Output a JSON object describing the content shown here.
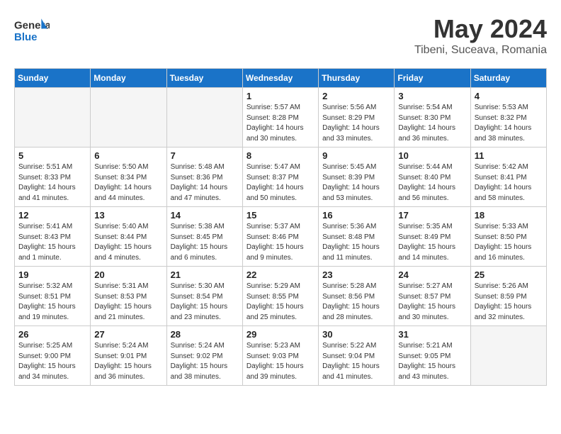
{
  "header": {
    "logo_line1": "General",
    "logo_line2": "Blue",
    "month": "May 2024",
    "location": "Tibeni, Suceava, Romania"
  },
  "days_of_week": [
    "Sunday",
    "Monday",
    "Tuesday",
    "Wednesday",
    "Thursday",
    "Friday",
    "Saturday"
  ],
  "weeks": [
    [
      {
        "day": "",
        "info": ""
      },
      {
        "day": "",
        "info": ""
      },
      {
        "day": "",
        "info": ""
      },
      {
        "day": "1",
        "info": "Sunrise: 5:57 AM\nSunset: 8:28 PM\nDaylight: 14 hours\nand 30 minutes."
      },
      {
        "day": "2",
        "info": "Sunrise: 5:56 AM\nSunset: 8:29 PM\nDaylight: 14 hours\nand 33 minutes."
      },
      {
        "day": "3",
        "info": "Sunrise: 5:54 AM\nSunset: 8:30 PM\nDaylight: 14 hours\nand 36 minutes."
      },
      {
        "day": "4",
        "info": "Sunrise: 5:53 AM\nSunset: 8:32 PM\nDaylight: 14 hours\nand 38 minutes."
      }
    ],
    [
      {
        "day": "5",
        "info": "Sunrise: 5:51 AM\nSunset: 8:33 PM\nDaylight: 14 hours\nand 41 minutes."
      },
      {
        "day": "6",
        "info": "Sunrise: 5:50 AM\nSunset: 8:34 PM\nDaylight: 14 hours\nand 44 minutes."
      },
      {
        "day": "7",
        "info": "Sunrise: 5:48 AM\nSunset: 8:36 PM\nDaylight: 14 hours\nand 47 minutes."
      },
      {
        "day": "8",
        "info": "Sunrise: 5:47 AM\nSunset: 8:37 PM\nDaylight: 14 hours\nand 50 minutes."
      },
      {
        "day": "9",
        "info": "Sunrise: 5:45 AM\nSunset: 8:39 PM\nDaylight: 14 hours\nand 53 minutes."
      },
      {
        "day": "10",
        "info": "Sunrise: 5:44 AM\nSunset: 8:40 PM\nDaylight: 14 hours\nand 56 minutes."
      },
      {
        "day": "11",
        "info": "Sunrise: 5:42 AM\nSunset: 8:41 PM\nDaylight: 14 hours\nand 58 minutes."
      }
    ],
    [
      {
        "day": "12",
        "info": "Sunrise: 5:41 AM\nSunset: 8:43 PM\nDaylight: 15 hours\nand 1 minute."
      },
      {
        "day": "13",
        "info": "Sunrise: 5:40 AM\nSunset: 8:44 PM\nDaylight: 15 hours\nand 4 minutes."
      },
      {
        "day": "14",
        "info": "Sunrise: 5:38 AM\nSunset: 8:45 PM\nDaylight: 15 hours\nand 6 minutes."
      },
      {
        "day": "15",
        "info": "Sunrise: 5:37 AM\nSunset: 8:46 PM\nDaylight: 15 hours\nand 9 minutes."
      },
      {
        "day": "16",
        "info": "Sunrise: 5:36 AM\nSunset: 8:48 PM\nDaylight: 15 hours\nand 11 minutes."
      },
      {
        "day": "17",
        "info": "Sunrise: 5:35 AM\nSunset: 8:49 PM\nDaylight: 15 hours\nand 14 minutes."
      },
      {
        "day": "18",
        "info": "Sunrise: 5:33 AM\nSunset: 8:50 PM\nDaylight: 15 hours\nand 16 minutes."
      }
    ],
    [
      {
        "day": "19",
        "info": "Sunrise: 5:32 AM\nSunset: 8:51 PM\nDaylight: 15 hours\nand 19 minutes."
      },
      {
        "day": "20",
        "info": "Sunrise: 5:31 AM\nSunset: 8:53 PM\nDaylight: 15 hours\nand 21 minutes."
      },
      {
        "day": "21",
        "info": "Sunrise: 5:30 AM\nSunset: 8:54 PM\nDaylight: 15 hours\nand 23 minutes."
      },
      {
        "day": "22",
        "info": "Sunrise: 5:29 AM\nSunset: 8:55 PM\nDaylight: 15 hours\nand 25 minutes."
      },
      {
        "day": "23",
        "info": "Sunrise: 5:28 AM\nSunset: 8:56 PM\nDaylight: 15 hours\nand 28 minutes."
      },
      {
        "day": "24",
        "info": "Sunrise: 5:27 AM\nSunset: 8:57 PM\nDaylight: 15 hours\nand 30 minutes."
      },
      {
        "day": "25",
        "info": "Sunrise: 5:26 AM\nSunset: 8:59 PM\nDaylight: 15 hours\nand 32 minutes."
      }
    ],
    [
      {
        "day": "26",
        "info": "Sunrise: 5:25 AM\nSunset: 9:00 PM\nDaylight: 15 hours\nand 34 minutes."
      },
      {
        "day": "27",
        "info": "Sunrise: 5:24 AM\nSunset: 9:01 PM\nDaylight: 15 hours\nand 36 minutes."
      },
      {
        "day": "28",
        "info": "Sunrise: 5:24 AM\nSunset: 9:02 PM\nDaylight: 15 hours\nand 38 minutes."
      },
      {
        "day": "29",
        "info": "Sunrise: 5:23 AM\nSunset: 9:03 PM\nDaylight: 15 hours\nand 39 minutes."
      },
      {
        "day": "30",
        "info": "Sunrise: 5:22 AM\nSunset: 9:04 PM\nDaylight: 15 hours\nand 41 minutes."
      },
      {
        "day": "31",
        "info": "Sunrise: 5:21 AM\nSunset: 9:05 PM\nDaylight: 15 hours\nand 43 minutes."
      },
      {
        "day": "",
        "info": ""
      }
    ]
  ]
}
